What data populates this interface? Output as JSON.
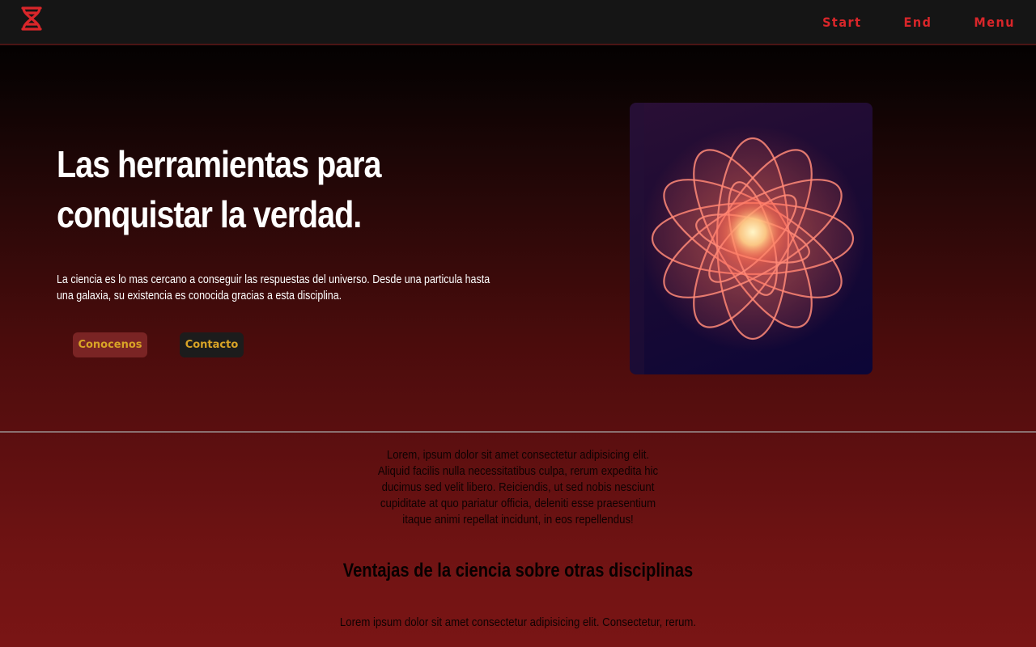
{
  "nav": {
    "logo_icon": "dna-icon",
    "links": [
      "Start",
      "End",
      "Menu"
    ]
  },
  "hero": {
    "title": "Las herramientas para conquistar la verdad.",
    "description": "La ciencia es lo mas cercano a conseguir las respuestas del universo. Desde una particula hasta una galaxia, su existencia es conocida gracias a esta disciplina.",
    "buttons": {
      "primary": "Conocenos",
      "secondary": "Contacto"
    },
    "image_icon": "atom-icon"
  },
  "section": {
    "intro": "Lorem, ipsum dolor sit amet consectetur adipisicing elit. Aliquid facilis nulla necessitatibus culpa, rerum expedita hic ducimus sed velit libero. Reiciendis, ut sed nobis nesciunt cupiditate at quo pariatur officia, deleniti esse praesentium itaque animi repellat incidunt, in eos repellendus!",
    "heading": "Ventajas de la ciencia sobre otras disciplinas",
    "text": "Lorem ipsum dolor sit amet consectetur adipisicing elit. Consectetur, rerum."
  },
  "colors": {
    "accent": "#d9262a",
    "button_text": "#d8a326",
    "navbar_bg": "#151515"
  }
}
